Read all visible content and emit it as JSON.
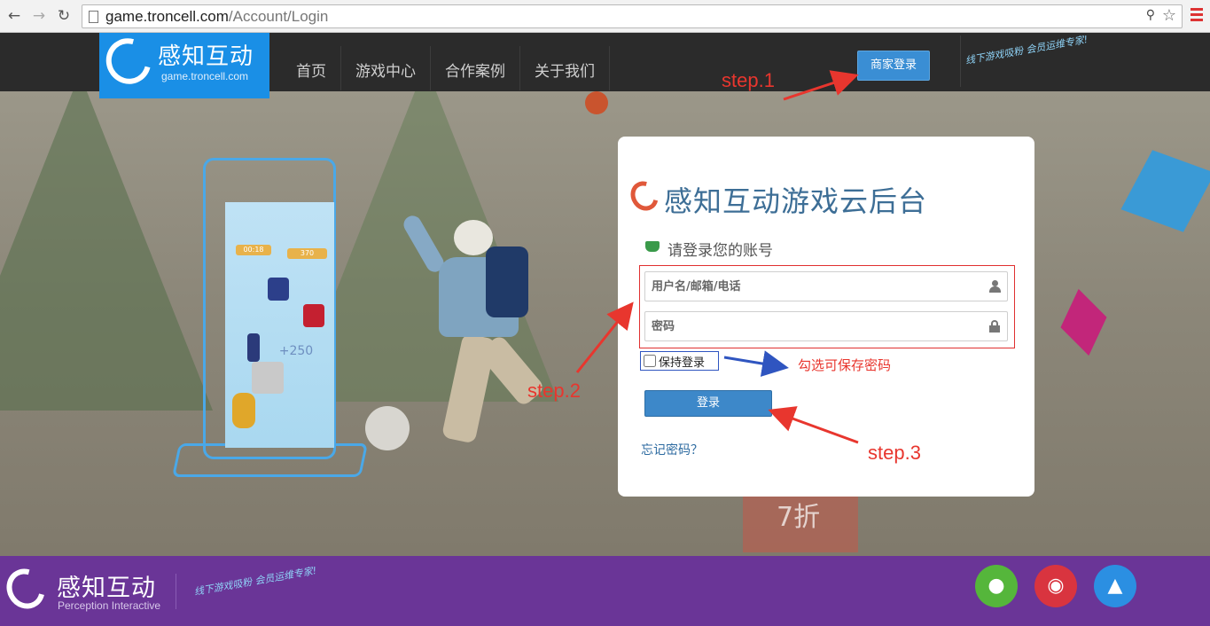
{
  "browser": {
    "url_host": "game.troncell.com",
    "url_path": "/Account/Login"
  },
  "header": {
    "logo_cn": "感知互动",
    "logo_en": "game.troncell.com",
    "nav": [
      "首页",
      "游戏中心",
      "合作案例",
      "关于我们"
    ],
    "merchant_login": "商家登录",
    "slogan": "线下游戏吸粉 会员运维专家!"
  },
  "card": {
    "title": "感知互动游戏云后台",
    "subtitle": "请登录您的账号",
    "username_placeholder": "用户名/邮箱/电话",
    "password_placeholder": "密码",
    "remember_label": "保持登录",
    "login_button": "登录",
    "forgot_link": "忘记密码？"
  },
  "annotations": {
    "step1": "step.1",
    "step2": "step.2",
    "step3": "step.3",
    "remember_hint": "勾选可保存密码"
  },
  "scene": {
    "kiosk_timer": "00:18",
    "kiosk_score": "370",
    "kiosk_bonus": "+250",
    "poster_text": "7折"
  },
  "footer": {
    "logo_cn": "感知互动",
    "logo_en": "Perception Interactive",
    "slogan": "线下游戏吸粉 会员运维专家!",
    "social": [
      {
        "icon": "wechat-icon",
        "color": "#55b63b"
      },
      {
        "icon": "weibo-icon",
        "color": "#d9343f"
      },
      {
        "icon": "qq-icon",
        "color": "#2b8fe2"
      }
    ]
  },
  "colors": {
    "header_bg": "#2b2b2b",
    "brand_blue": "#1a8fe6",
    "footer_purple": "#6a3597",
    "annotation_red": "#e8362e",
    "button_blue": "#3d88c9"
  }
}
